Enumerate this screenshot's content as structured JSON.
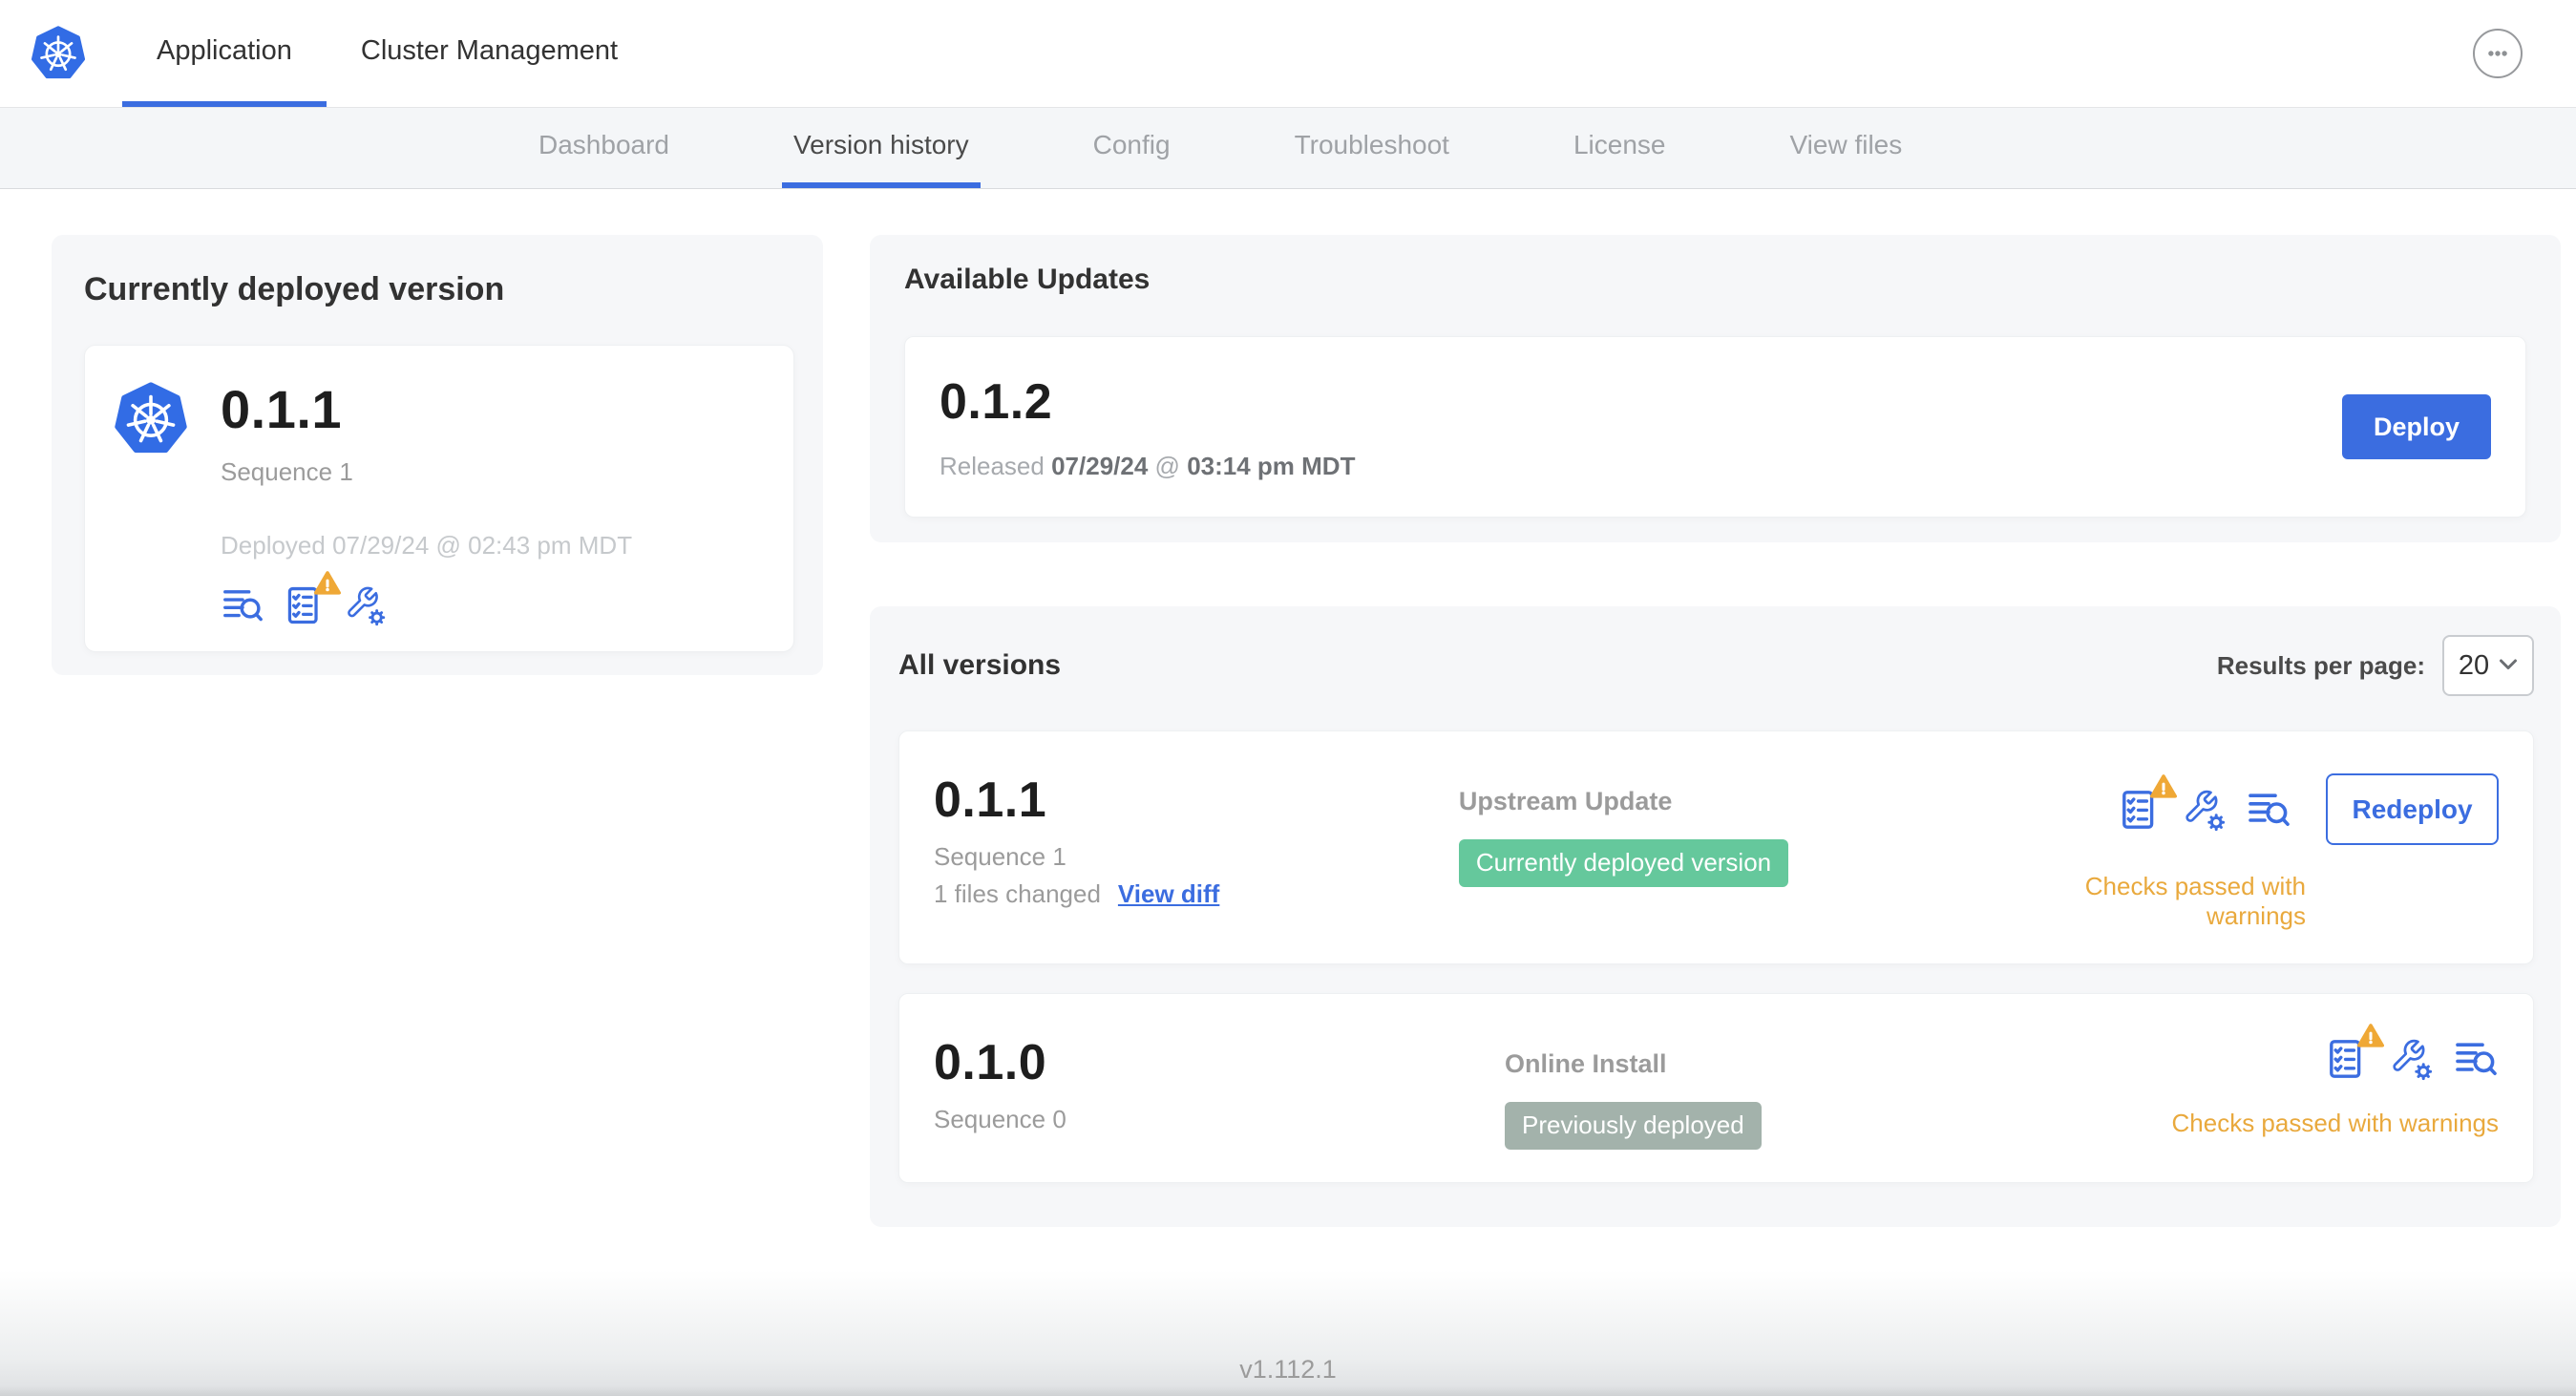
{
  "header": {
    "app_tabs": [
      {
        "label": "Application",
        "active": true
      },
      {
        "label": "Cluster Management",
        "active": false
      }
    ]
  },
  "subnav": {
    "tabs": [
      "Dashboard",
      "Version history",
      "Config",
      "Troubleshoot",
      "License",
      "View files"
    ],
    "active": "Version history"
  },
  "current_version": {
    "title": "Currently deployed version",
    "version": "0.1.1",
    "sequence": "Sequence 1",
    "deployed": "Deployed 07/29/24 @ 02:43 pm MDT"
  },
  "available_updates": {
    "title": "Available Updates",
    "version": "0.1.2",
    "released_prefix": "Released",
    "released_date": "07/29/24",
    "released_separator": "@",
    "released_time": "03:14 pm MDT",
    "deploy_label": "Deploy"
  },
  "all_versions": {
    "title": "All versions",
    "results_per_page_label": "Results per page:",
    "results_per_page_value": "20",
    "rows": [
      {
        "version": "0.1.1",
        "sequence": "Sequence 1",
        "files_changed": "1 files changed",
        "view_diff_label": "View diff",
        "source": "Upstream Update",
        "badge": "Currently deployed version",
        "badge_type": "green",
        "action_label": "Redeploy",
        "status": "Checks passed with warnings"
      },
      {
        "version": "0.1.0",
        "sequence": "Sequence 0",
        "source": "Online Install",
        "badge": "Previously deployed",
        "badge_type": "gray",
        "status": "Checks passed with warnings"
      }
    ]
  },
  "footer": {
    "version_label": "v1.112.1"
  },
  "icons": {
    "logo": "kubernetes-logo",
    "menu": "ellipsis-icon",
    "row_icons": [
      "preflight-checks-warning-icon",
      "config-icon",
      "logs-icon"
    ],
    "current_version_icons": [
      "logs-icon",
      "preflight-checks-warning-icon",
      "config-icon"
    ],
    "select_chevron": "chevron-down-icon"
  },
  "colors": {
    "accent_blue": "#3b6de0",
    "kubernetes_blue": "#326ce5",
    "badge_green": "#65c89c",
    "badge_gray": "#a3b2ab",
    "warning_orange": "#e9a93d",
    "warning_triangle": "#efa836"
  }
}
